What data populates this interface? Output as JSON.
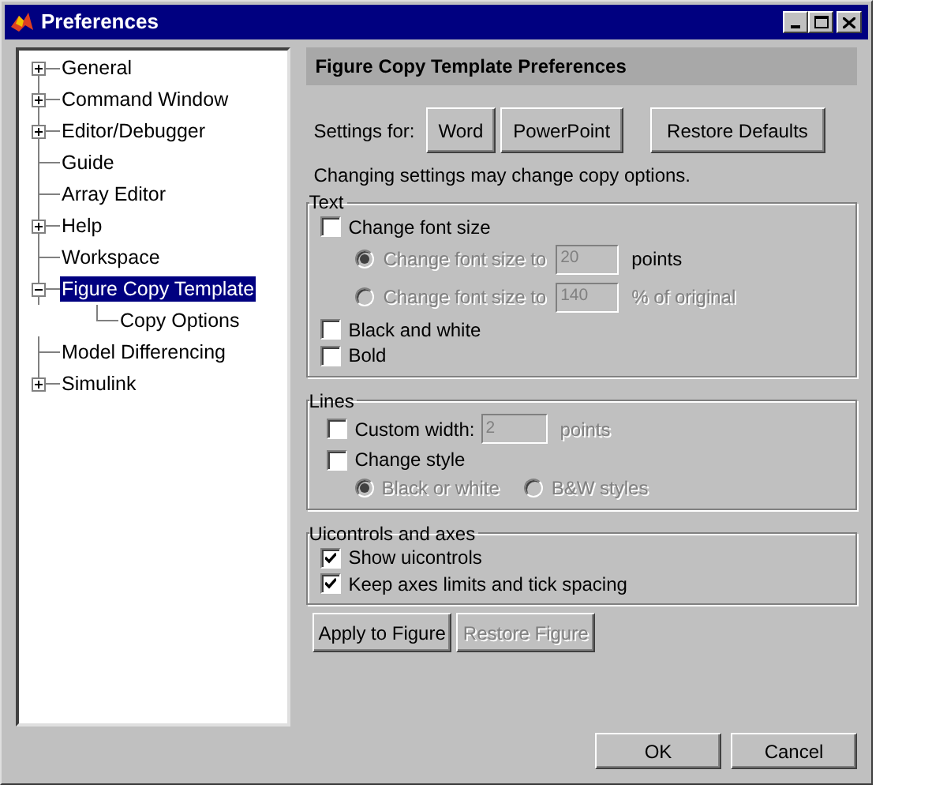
{
  "window": {
    "title": "Preferences"
  },
  "tree": [
    {
      "label": "General",
      "expanded": false,
      "selected": false
    },
    {
      "label": "Command Window",
      "expanded": false,
      "selected": false
    },
    {
      "label": "Editor/Debugger",
      "expanded": false,
      "selected": false
    },
    {
      "label": "Guide",
      "selected": false
    },
    {
      "label": "Array Editor",
      "selected": false
    },
    {
      "label": "Help",
      "expanded": false,
      "selected": false
    },
    {
      "label": "Workspace",
      "selected": false
    },
    {
      "label": "Figure Copy Template",
      "expanded": true,
      "selected": true,
      "children": [
        {
          "label": "Copy Options",
          "selected": false
        }
      ]
    },
    {
      "label": "Model Differencing",
      "selected": false
    },
    {
      "label": "Simulink",
      "expanded": false,
      "selected": false
    }
  ],
  "panel": {
    "title": "Figure Copy Template Preferences",
    "settings_label": "Settings for:",
    "settings_buttons": [
      "Word",
      "PowerPoint",
      "Restore Defaults"
    ],
    "note": "Changing settings may change copy options.",
    "groups": [
      {
        "title": "Text",
        "items": [
          {
            "kind": "checkbox",
            "label": "Change font size",
            "checked": false
          },
          {
            "kind": "radio",
            "label": "Change font size to",
            "selected": true,
            "disabled": true,
            "field": {
              "value": "20",
              "disabled": true
            },
            "suffix": {
              "text": "points",
              "disabled": false
            }
          },
          {
            "kind": "radio",
            "label": "Change font size to",
            "selected": false,
            "disabled": true,
            "field": {
              "value": "140",
              "disabled": true
            },
            "suffix": {
              "text": "% of original",
              "disabled": true
            }
          },
          {
            "kind": "checkbox",
            "label": "Black and white",
            "checked": false
          },
          {
            "kind": "checkbox",
            "label": "Bold",
            "checked": false
          }
        ]
      },
      {
        "title": "Lines",
        "items": [
          {
            "kind": "checkbox",
            "label": "Custom width:",
            "checked": false,
            "field": {
              "value": "2",
              "disabled": true
            },
            "suffix": {
              "text": "points",
              "disabled": true
            }
          },
          {
            "kind": "checkbox",
            "label": "Change style",
            "checked": false
          },
          {
            "kind": "radio_row",
            "options": [
              {
                "label": "Black or white",
                "selected": true,
                "disabled": true
              },
              {
                "label": "B&W styles",
                "selected": false,
                "disabled": true
              }
            ]
          }
        ]
      },
      {
        "title": "Uicontrols and axes",
        "items": [
          {
            "kind": "checkbox",
            "label": "Show uicontrols",
            "checked": true
          },
          {
            "kind": "checkbox",
            "label": "Keep axes limits and tick spacing",
            "checked": true
          }
        ]
      }
    ],
    "actions": [
      {
        "label": "Apply to Figure",
        "disabled": false
      },
      {
        "label": "Restore Figure",
        "disabled": true
      }
    ]
  },
  "footer_buttons": [
    "OK",
    "Cancel"
  ]
}
